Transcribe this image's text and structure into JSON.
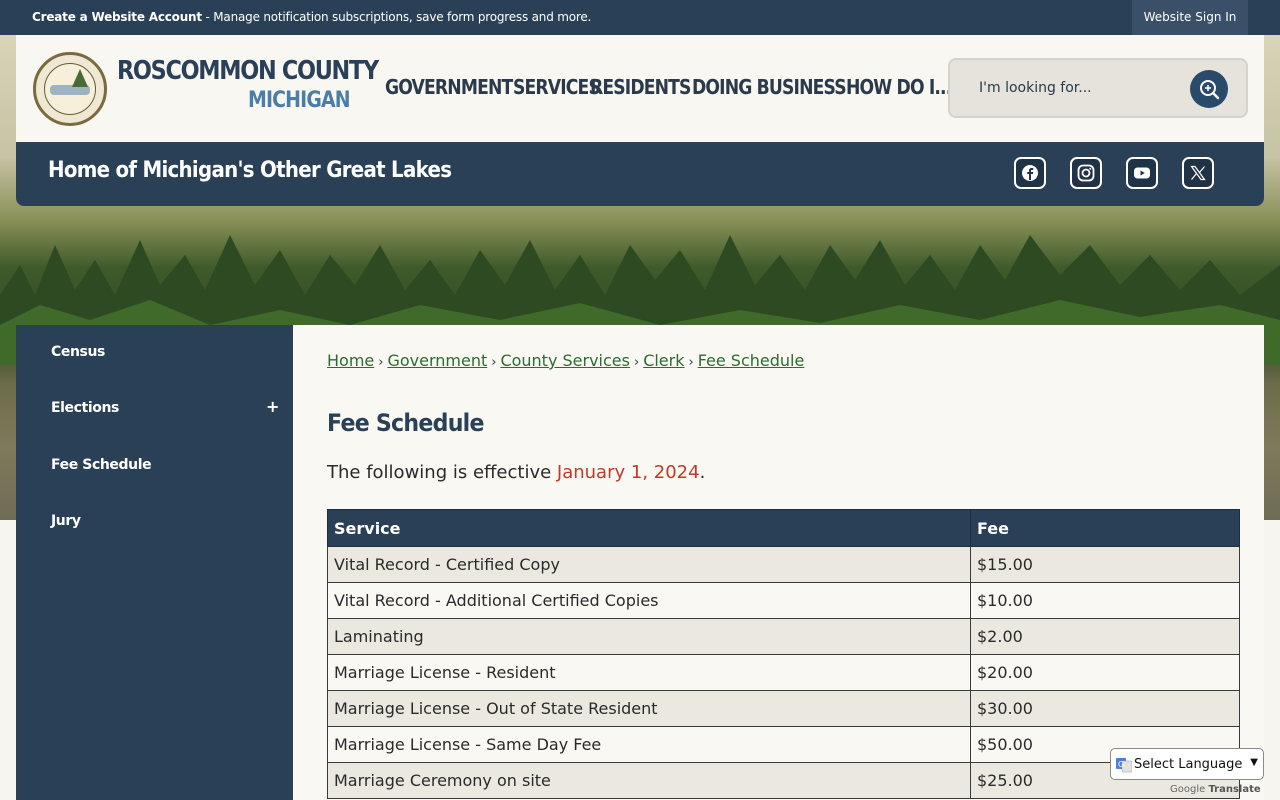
{
  "topbar": {
    "create_bold": "Create a Website Account",
    "create_rest": " - Manage notification subscriptions, save form progress and more.",
    "signin": "Website Sign In"
  },
  "header": {
    "logo_line1": "ROSCOMMON COUNTY",
    "logo_line2": "MICHIGAN",
    "nav": [
      "GOVERNMENT",
      "SERVICES",
      "RESIDENTS",
      "DOING BUSINESS",
      "HOW DO I..."
    ],
    "search_placeholder": "I'm looking for...",
    "tagline": "Home of Michigan's Other Great Lakes",
    "social": [
      "facebook-icon",
      "instagram-icon",
      "youtube-icon",
      "x-twitter-icon"
    ]
  },
  "sidebar": {
    "items": [
      "Census",
      "Elections",
      "Fee Schedule",
      "Jury"
    ],
    "expand": "+"
  },
  "breadcrumb": [
    "Home",
    "Government",
    "County Services",
    "Clerk",
    "Fee Schedule"
  ],
  "page": {
    "title": "Fee Schedule",
    "intro_text": "The following is effective ",
    "intro_date": "January 1, 2024",
    "intro_end": "."
  },
  "table": {
    "headers": [
      "Service",
      "Fee"
    ],
    "rows": [
      [
        "Vital Record - Certified Copy",
        "$15.00"
      ],
      [
        "Vital Record - Additional Certified Copies",
        "$10.00"
      ],
      [
        "Laminating",
        "$2.00"
      ],
      [
        "Marriage License - Resident",
        "$20.00"
      ],
      [
        "Marriage License - Out of State Resident",
        "$30.00"
      ],
      [
        "Marriage License - Same Day Fee",
        "$50.00"
      ],
      [
        "Marriage Ceremony on site",
        "$25.00"
      ]
    ]
  },
  "translate": {
    "select_label": "Select Language",
    "powered_by": "Google",
    "translate_word": "Translate"
  },
  "colors": {
    "navy": "#2a4057",
    "link_green": "#2f6b2f",
    "date_red": "#c0392b"
  }
}
